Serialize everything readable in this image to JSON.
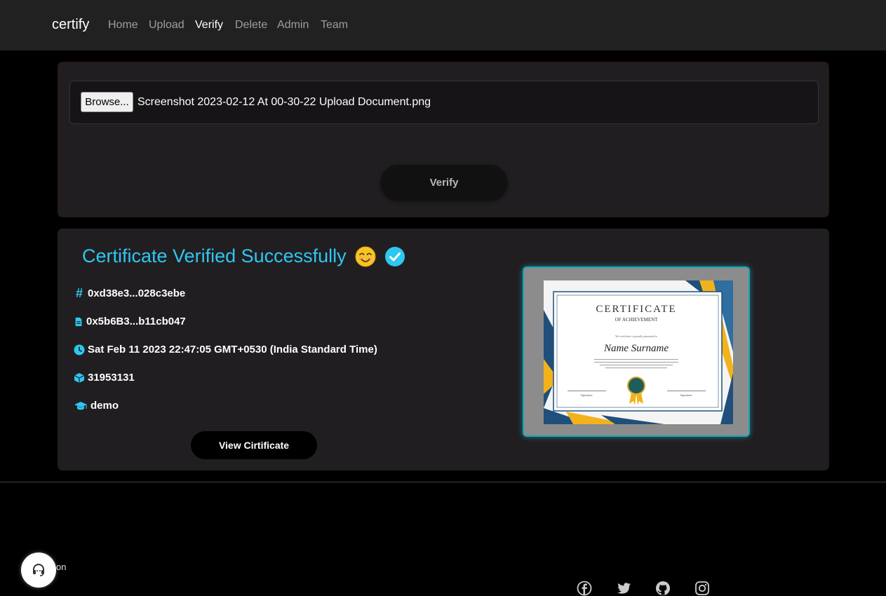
{
  "nav": {
    "brand": "certify",
    "links": [
      "Home",
      "Upload",
      "Verify",
      "Delete",
      "Admin",
      "Team"
    ],
    "active": "Verify"
  },
  "upload": {
    "browse_label": "Browse...",
    "file_name": "Screenshot 2023-02-12 At 00-30-22 Upload Document.png",
    "verify_label": "Verify"
  },
  "result": {
    "title": "Certificate Verified Successfully",
    "hash": "0xd38e3...028c3ebe",
    "address": "0x5b6B3...b11cb047",
    "timestamp": "Sat Feb 11 2023 22:47:05 GMT+0530 (India Standard Time)",
    "block": "31953131",
    "course": "demo",
    "view_label": "View Cirtificate"
  },
  "certificate_image": {
    "heading": "CERTIFICATE",
    "subheading": "OF ACHIEVEMENT",
    "presented": "We certificate is proudly presented to",
    "name": "Name Surname",
    "sig_left": "Signature",
    "sig_right": "Signature"
  },
  "footer": {
    "support_text": "on",
    "social_icons": [
      "facebook-icon",
      "twitter-icon",
      "github-icon",
      "instagram-icon"
    ]
  },
  "colors": {
    "accent": "#2ec7f0",
    "panel": "#211e21",
    "navbar": "#212121"
  }
}
